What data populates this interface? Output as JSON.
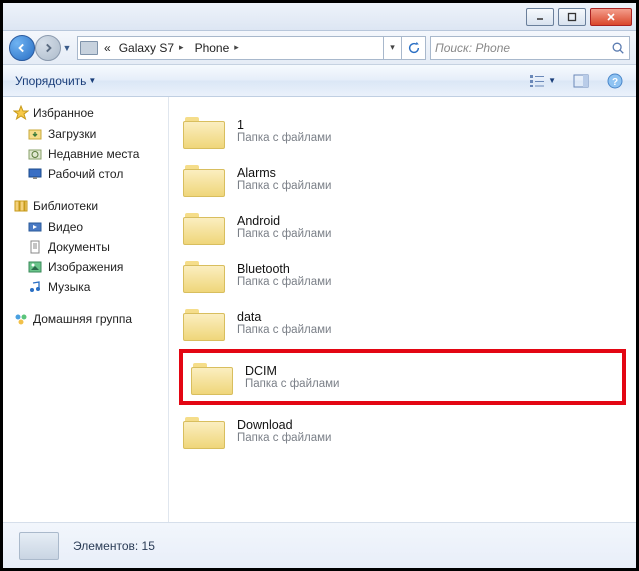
{
  "titlebar": {
    "minimize": "–",
    "maximize": "▢",
    "close": "×"
  },
  "nav": {
    "back_arrow": "←",
    "fwd_arrow": "→",
    "breadcrumb_prefix": "«",
    "crumb1": "Galaxy S7",
    "crumb2": "Phone",
    "search_placeholder": "Поиск: Phone"
  },
  "toolbar": {
    "organize": "Упорядочить"
  },
  "sidebar": {
    "favorites": {
      "label": "Избранное",
      "items": [
        "Загрузки",
        "Недавние места",
        "Рабочий стол"
      ]
    },
    "libraries": {
      "label": "Библиотеки",
      "items": [
        "Видео",
        "Документы",
        "Изображения",
        "Музыка"
      ]
    },
    "homegroup": "Домашняя группа"
  },
  "folders": [
    {
      "name": "1",
      "sub": "Папка с файлами"
    },
    {
      "name": "Alarms",
      "sub": "Папка с файлами"
    },
    {
      "name": "Android",
      "sub": "Папка с файлами"
    },
    {
      "name": "Bluetooth",
      "sub": "Папка с файлами"
    },
    {
      "name": "data",
      "sub": "Папка с файлами"
    },
    {
      "name": "DCIM",
      "sub": "Папка с файлами",
      "highlighted": true
    },
    {
      "name": "Download",
      "sub": "Папка с файлами"
    }
  ],
  "status": {
    "text": "Элементов: 15"
  }
}
